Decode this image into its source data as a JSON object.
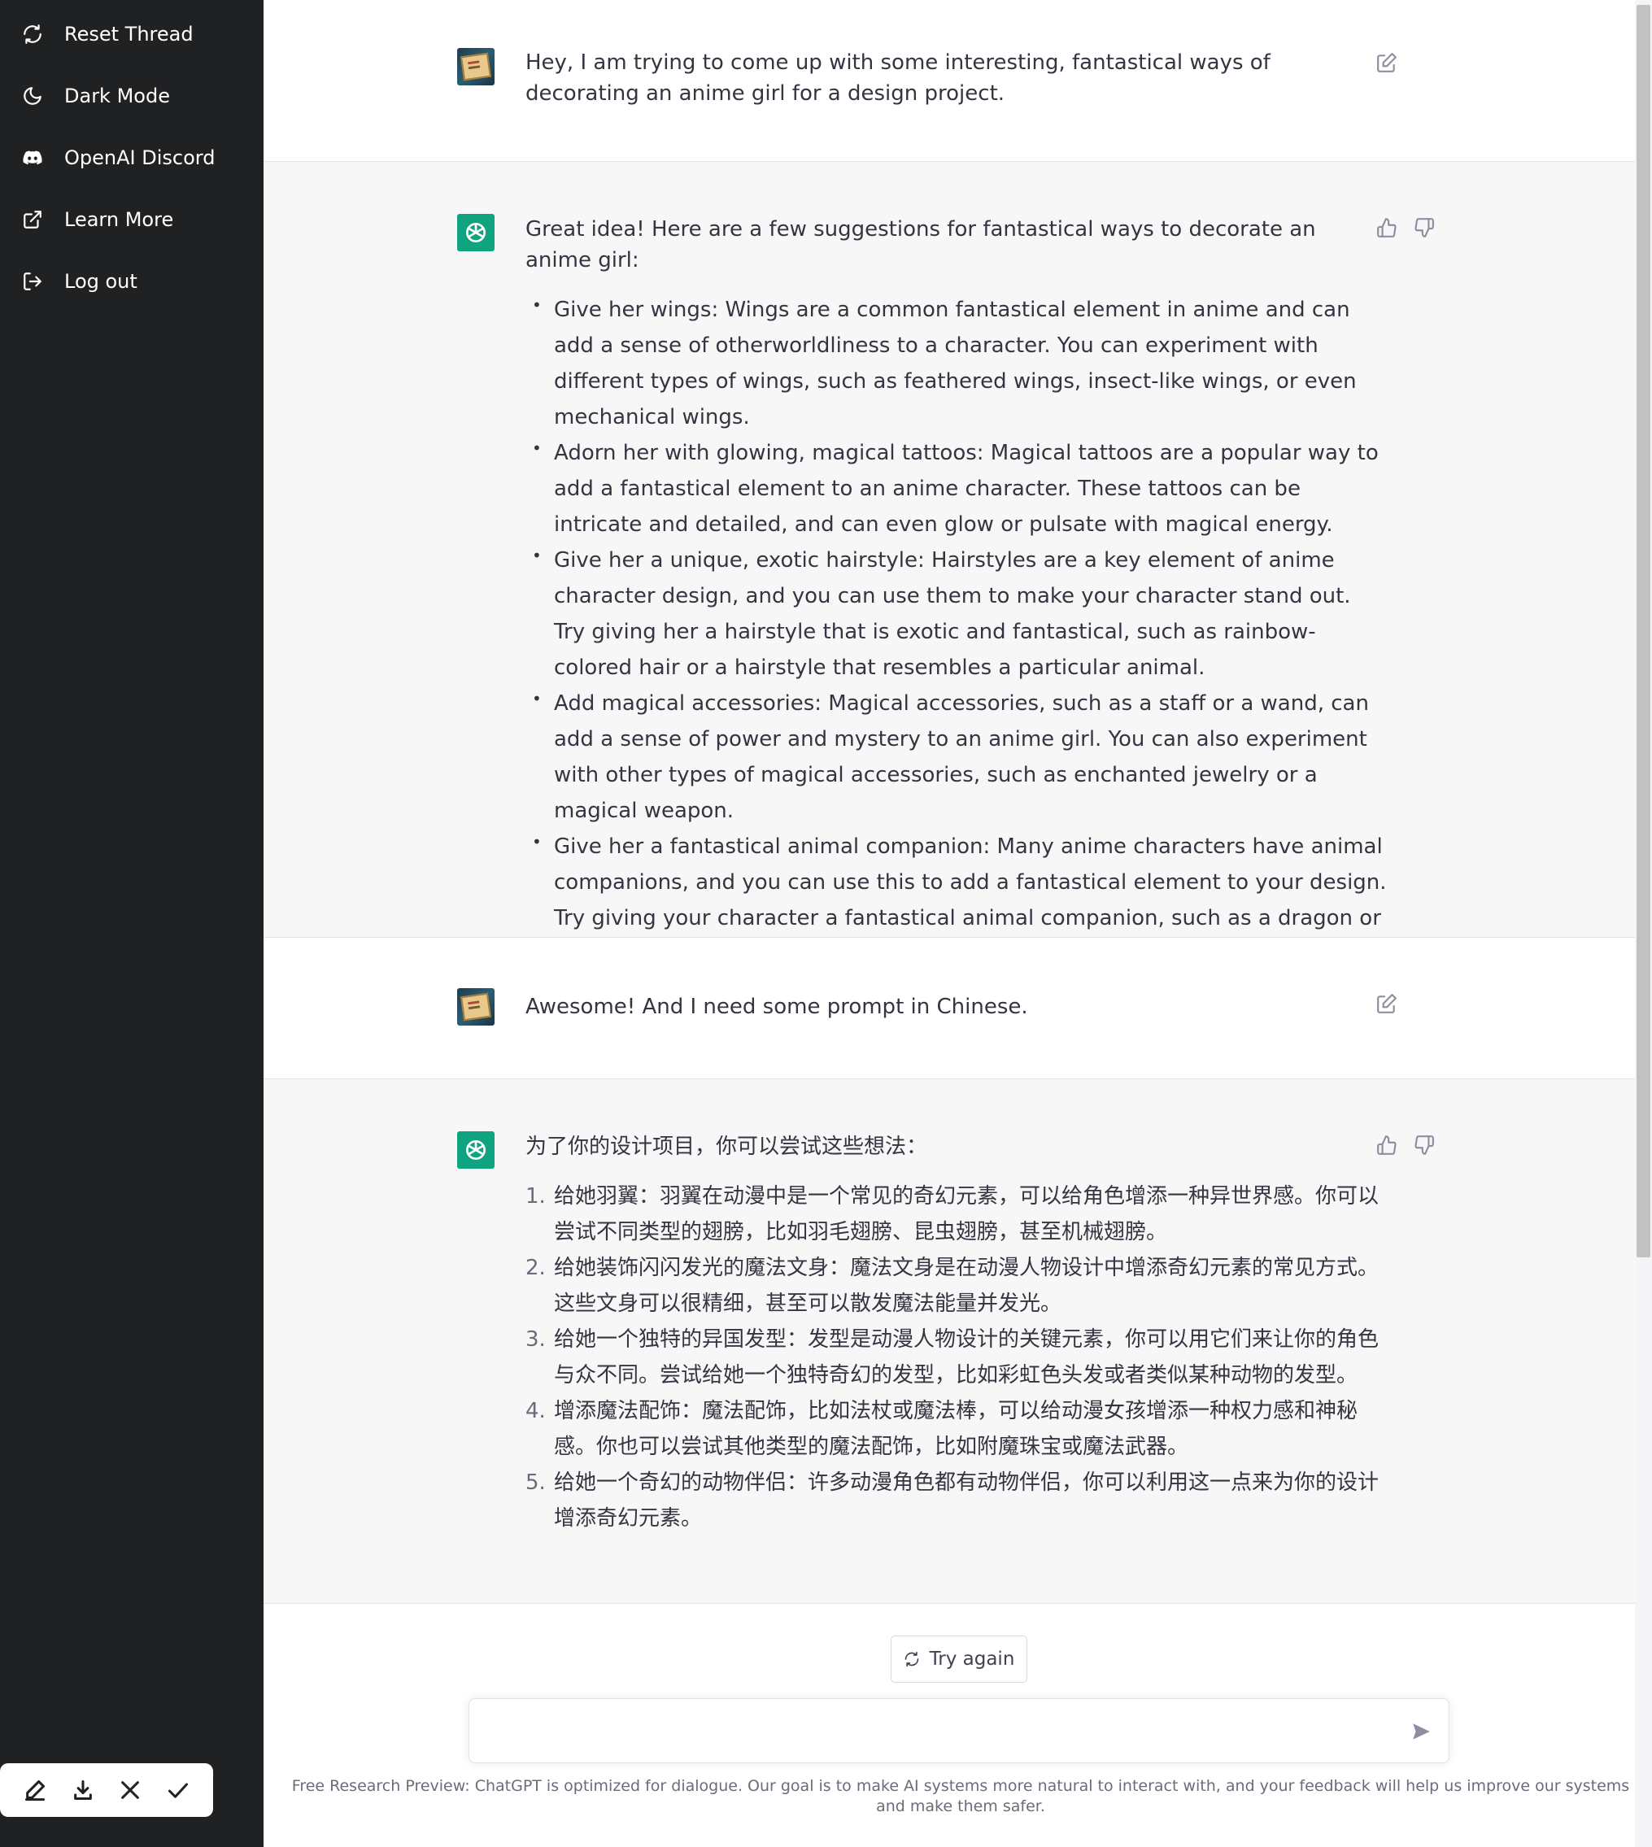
{
  "sidebar": {
    "items": [
      {
        "label": "Reset Thread",
        "icon": "refresh-icon"
      },
      {
        "label": "Dark Mode",
        "icon": "moon-icon"
      },
      {
        "label": "OpenAI Discord",
        "icon": "discord-icon"
      },
      {
        "label": "Learn More",
        "icon": "external-link-icon"
      },
      {
        "label": "Log out",
        "icon": "logout-icon"
      }
    ]
  },
  "toolbar": {
    "icons": [
      "pen-icon",
      "download-icon",
      "close-icon",
      "check-icon"
    ]
  },
  "conversation": {
    "msg1": {
      "text": "Hey, I am trying to come up with some interesting, fantastical ways of decorating an anime girl for a design project."
    },
    "msg2": {
      "intro": "Great idea! Here are a few suggestions for fantastical ways to decorate an anime girl:",
      "items": [
        "Give her wings: Wings are a common fantastical element in anime and can add a sense of otherworldliness to a character. You can experiment with different types of wings, such as feathered wings, insect-like wings, or even mechanical wings.",
        "Adorn her with glowing, magical tattoos: Magical tattoos are a popular way to add a fantastical element to an anime character. These tattoos can be intricate and detailed, and can even glow or pulsate with magical energy.",
        "Give her a unique, exotic hairstyle: Hairstyles are a key element of anime character design, and you can use them to make your character stand out. Try giving her a hairstyle that is exotic and fantastical, such as rainbow-colored hair or a hairstyle that resembles a particular animal.",
        "Add magical accessories: Magical accessories, such as a staff or a wand, can add a sense of power and mystery to an anime girl. You can also experiment with other types of magical accessories, such as enchanted jewelry or a magical weapon.",
        "Give her a fantastical animal companion: Many anime characters have animal companions, and you can use this to add a fantastical element to your design. Try giving your character a fantastical animal companion, such as a dragon or a griffin, to add a touch of magic to your design."
      ]
    },
    "msg3": {
      "text": "Awesome! And I need some prompt in Chinese."
    },
    "msg4": {
      "intro": "为了你的设计项目，你可以尝试这些想法：",
      "items": [
        {
          "num": "1.",
          "text": "给她羽翼：羽翼在动漫中是一个常见的奇幻元素，可以给角色增添一种异世界感。你可以尝试不同类型的翅膀，比如羽毛翅膀、昆虫翅膀，甚至机械翅膀。"
        },
        {
          "num": "2.",
          "text": "给她装饰闪闪发光的魔法文身：魔法文身是在动漫人物设计中增添奇幻元素的常见方式。这些文身可以很精细，甚至可以散发魔法能量并发光。"
        },
        {
          "num": "3.",
          "text": "给她一个独特的异国发型：发型是动漫人物设计的关键元素，你可以用它们来让你的角色与众不同。尝试给她一个独特奇幻的发型，比如彩虹色头发或者类似某种动物的发型。"
        },
        {
          "num": "4.",
          "text": "增添魔法配饰：魔法配饰，比如法杖或魔法棒，可以给动漫女孩增添一种权力感和神秘感。你也可以尝试其他类型的魔法配饰，比如附魔珠宝或魔法武器。"
        },
        {
          "num": "5.",
          "text": "给她一个奇幻的动物伴侣：许多动漫角色都有动物伴侣，你可以利用这一点来为你的设计增添奇幻元素。"
        }
      ]
    }
  },
  "actions": {
    "try_again": "Try again"
  },
  "composer": {
    "value": "",
    "placeholder": ""
  },
  "footer": {
    "text": "Free Research Preview: ChatGPT is optimized for dialogue. Our goal is to make AI systems more natural to interact with, and your feedback will help us improve our systems and make them safer."
  },
  "colors": {
    "sidebar_bg": "#202123",
    "bot_row_bg": "#f7f7f8",
    "brand_green": "#10a37f",
    "icon_gray": "#8e8ea0"
  }
}
